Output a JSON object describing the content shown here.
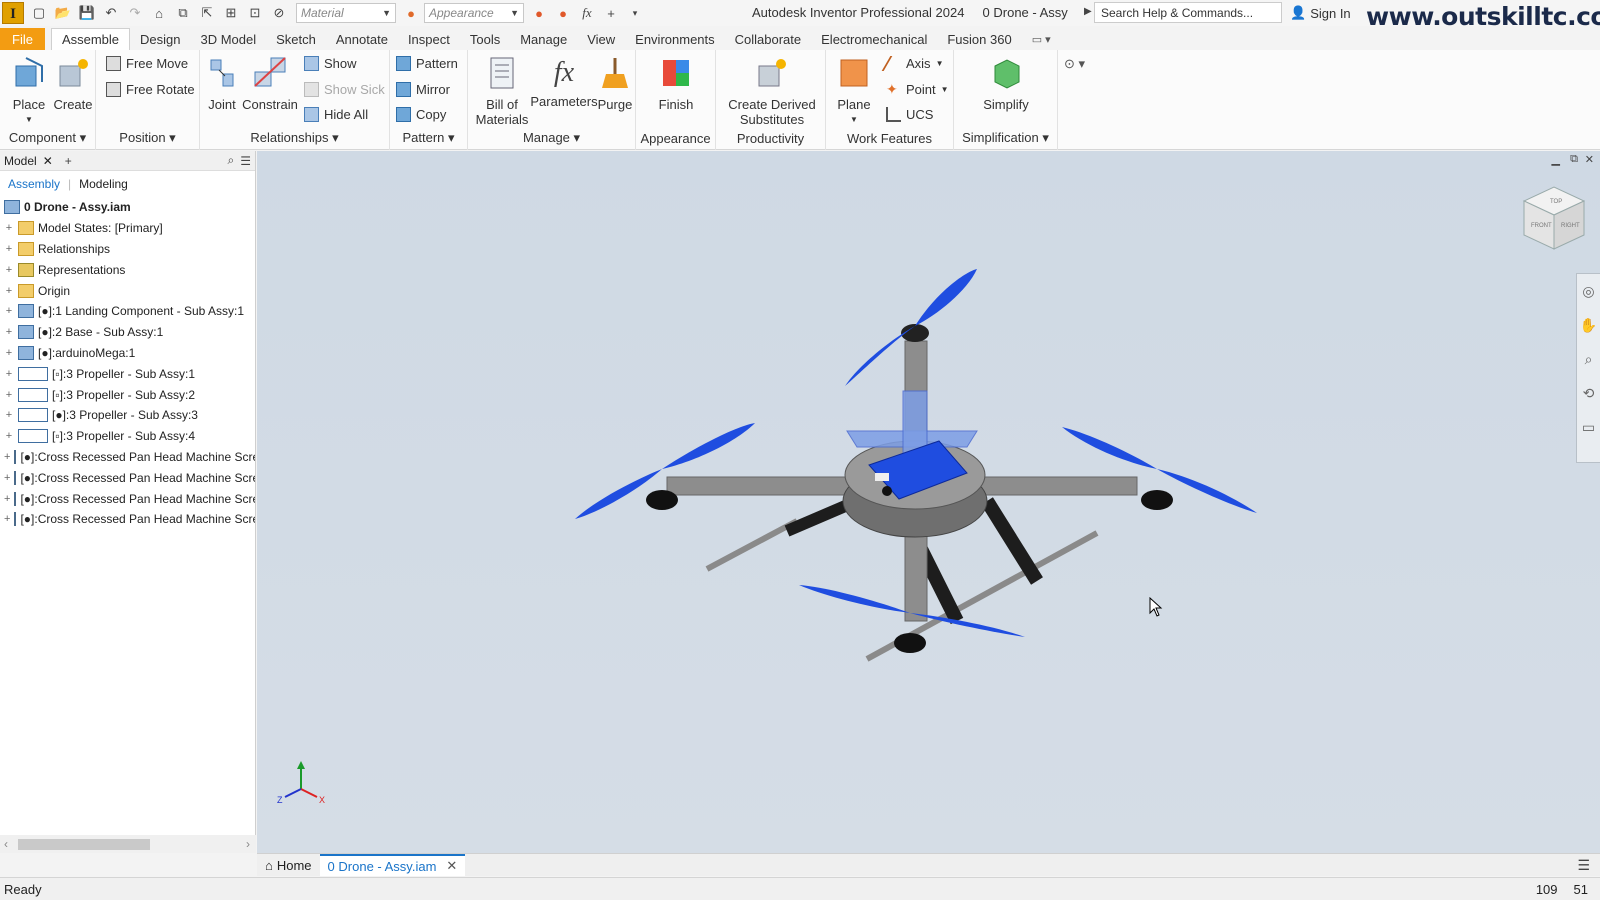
{
  "app": {
    "title": "Autodesk Inventor Professional 2024",
    "document": "0 Drone - Assy",
    "logo": "I",
    "watermark": "www.outskilltc.com"
  },
  "quick_access": {
    "material_placeholder": "Material",
    "appearance_placeholder": "Appearance",
    "search_placeholder": "Search Help & Commands...",
    "sign_in": "Sign In"
  },
  "tabs": [
    "File",
    "Assemble",
    "Design",
    "3D Model",
    "Sketch",
    "Annotate",
    "Inspect",
    "Tools",
    "Manage",
    "View",
    "Environments",
    "Collaborate",
    "Electromechanical",
    "Fusion 360"
  ],
  "active_tab": "Assemble",
  "ribbon": {
    "component": {
      "label": "Component",
      "place": "Place",
      "create": "Create"
    },
    "position": {
      "label": "Position",
      "free_move": "Free Move",
      "free_rotate": "Free Rotate"
    },
    "relationships": {
      "label": "Relationships",
      "joint": "Joint",
      "constrain": "Constrain",
      "show": "Show",
      "show_sick": "Show Sick",
      "hide_all": "Hide All"
    },
    "pattern": {
      "label": "Pattern",
      "pattern": "Pattern",
      "mirror": "Mirror",
      "copy": "Copy"
    },
    "manage": {
      "label": "Manage",
      "bom_line1": "Bill of",
      "bom_line2": "Materials",
      "parameters": "Parameters",
      "purge": "Purge"
    },
    "appearance": {
      "label": "Appearance",
      "finish": "Finish"
    },
    "productivity": {
      "label": "Productivity",
      "cds_line1": "Create Derived",
      "cds_line2": "Substitutes"
    },
    "work_features": {
      "label": "Work Features",
      "plane": "Plane",
      "axis": "Axis",
      "point": "Point",
      "ucs": "UCS"
    },
    "simplification": {
      "label": "Simplification",
      "simplify": "Simplify"
    }
  },
  "browser": {
    "tab": "Model",
    "sub_tabs": [
      "Assembly",
      "Modeling"
    ],
    "root": "0 Drone - Assy.iam",
    "items": [
      "Model States: [Primary]",
      "Relationships",
      "Representations",
      "Origin",
      "[●]:1 Landing Component - Sub Assy:1",
      "[●]:2 Base - Sub Assy:1",
      "[●]:arduinoMega:1",
      "[▫]:3 Propeller - Sub Assy:1",
      "[▫]:3 Propeller - Sub Assy:2",
      "[●]:3 Propeller - Sub Assy:3",
      "[▫]:3 Propeller - Sub Assy:4",
      "[●]:Cross Recessed Pan Head Machine Screw",
      "[●]:Cross Recessed Pan Head Machine Screw",
      "[●]:Cross Recessed Pan Head Machine Screw",
      "[●]:Cross Recessed Pan Head Machine Screw"
    ]
  },
  "viewcube": {
    "top": "TOP",
    "front": "FRONT",
    "right": "RIGHT"
  },
  "triad": {
    "x": "X",
    "z": "Z"
  },
  "doc_tabs": {
    "home": "Home",
    "active": "0 Drone - Assy.iam"
  },
  "status": {
    "text": "Ready",
    "coord1": "109",
    "coord2": "51"
  },
  "colors": {
    "file_tab": "#f39c12",
    "propeller": "#1f4de0",
    "viewport_bg": "#d2dbe5"
  }
}
